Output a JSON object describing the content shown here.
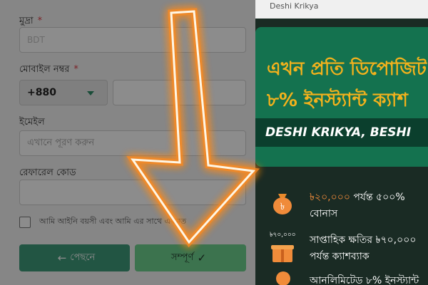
{
  "form": {
    "currency_label": "মুদ্রা",
    "required_mark": "*",
    "currency_value": "BDT",
    "phone_label": "মোবাইল নম্বর",
    "country_code": "+880",
    "email_label": "ইমেইল",
    "email_placeholder": "এখানে পূরণ করুন",
    "referral_label": "রেফারেল কোড",
    "agree_text": "আমি আইনি বয়সী এবং আমি এর সাথে একমত",
    "back_label": "পেছনে",
    "done_label": "সম্পূর্ণ"
  },
  "promo": {
    "top_text": "Deshi Krikya",
    "headline_line1": "এখন প্রতি ডিপোজিট",
    "headline_line2": "৮% ইনস্ট্যান্ট ক্যাশ",
    "tagline": "DESHI KRIKYA, BESHI",
    "perks": [
      {
        "amount": "৳২০,০০০",
        "text_a": " পর্যন্ত ৫০০%",
        "text_b": "বোনাস",
        "icon": "money-bag-icon"
      },
      {
        "small": "৳৭০,০০০",
        "text_a": "সাপ্তাহিক ক্ষতির ৳৭০,০০০",
        "text_b": "পর্যন্ত ক্যাশব্যাক",
        "icon": "gift-box-icon"
      },
      {
        "text_a": "আনলিমিটেড ৮% ইনস্ট্যান্ট",
        "icon": "coin-icon"
      }
    ]
  },
  "colors": {
    "accent_green": "#3f9b7b",
    "done_green": "#6dd18e",
    "banner_green": "#14724f",
    "gold": "#f4b21c",
    "arrow_orange": "#ff8a1e"
  }
}
